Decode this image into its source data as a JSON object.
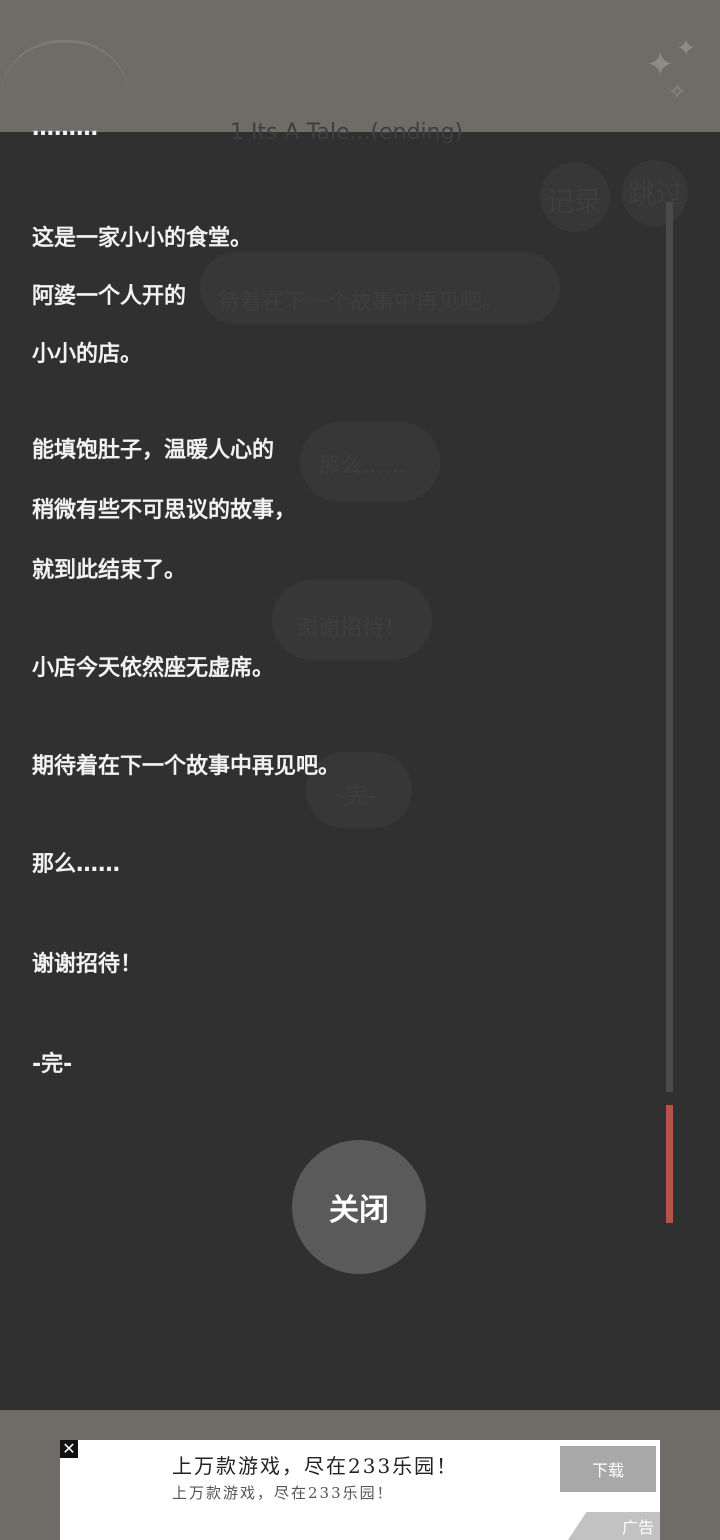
{
  "background": {
    "ghost_title": "1 Its A Tale...(ending)",
    "ghost_log_button": "记录",
    "ghost_skip_button": "跳过",
    "ghost_bubble_1": "待着在下一个故事中再见吧。",
    "ghost_bubble_2": "那么……",
    "ghost_bubble_3": "谢谢招待！",
    "ghost_bubble_4": "-完-"
  },
  "log": {
    "lines": [
      "………",
      "这是一家小小的食堂。",
      "阿婆一个人开的",
      "小小的店。",
      "能填饱肚子，温暖人心的",
      "稍微有些不可思议的故事，",
      "就到此结束了。",
      "小店今天依然座无虚席。",
      "期待着在下一个故事中再见吧。",
      "那么……",
      "谢谢招待！",
      "-完-"
    ],
    "scroll_position": 0.95
  },
  "close_button": {
    "label": "关闭"
  },
  "ad": {
    "close": "✕",
    "title": "上万款游戏，尽在233乐园！",
    "subtitle": "上万款游戏，尽在233乐园！",
    "download_label": "下载",
    "badge": "广告"
  },
  "colors": {
    "overlay": "#303030",
    "text": "#f2f2f2",
    "scroll_thumb": "#b4554a",
    "close_button": "#5a5a5a"
  }
}
